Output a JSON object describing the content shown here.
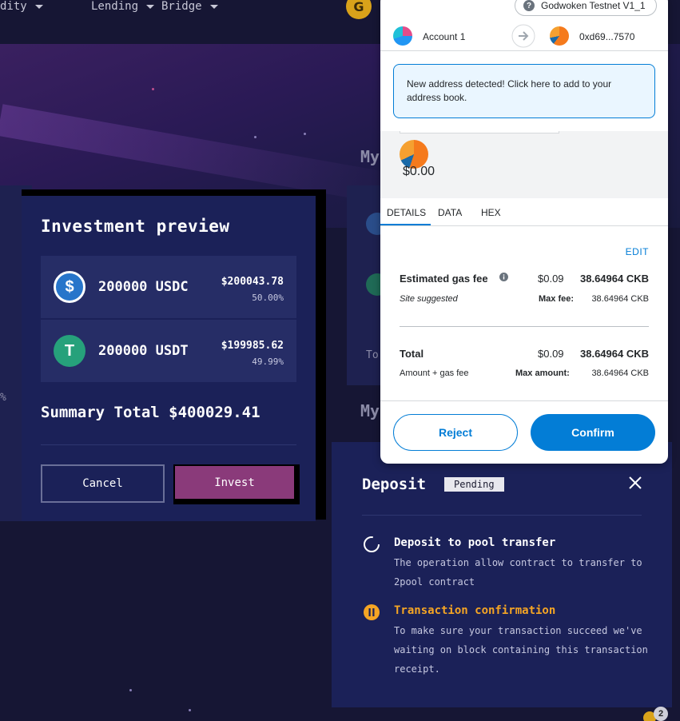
{
  "nav": {
    "items": [
      {
        "label": "dity"
      },
      {
        "label": "Lending"
      },
      {
        "label": "Bridge"
      }
    ],
    "logo_letter": "G"
  },
  "background": {
    "section_heading_1": "My",
    "section_heading_2": "My",
    "total_label": "To",
    "percent_fragment": "%"
  },
  "investment_preview": {
    "title": "Investment preview",
    "rows": [
      {
        "coin": "USDC",
        "amount": "200000 USDC",
        "usd": "$200043.78",
        "percent": "50.00%",
        "color": "#2775ca",
        "glyph": "$"
      },
      {
        "coin": "USDT",
        "amount": "200000 USDT",
        "usd": "$199985.62",
        "percent": "49.99%",
        "color": "#26a17b",
        "glyph": "T"
      }
    ],
    "summary": "Summary Total $400029.41",
    "cancel_label": "Cancel",
    "invest_label": "Invest"
  },
  "deposit": {
    "title": "Deposit",
    "status": "Pending",
    "steps": [
      {
        "title": "Deposit to pool transfer",
        "desc": "The operation allow contract to transfer to 2pool contract",
        "color": "#ffffff"
      },
      {
        "title": "Transaction confirmation",
        "desc": "To make sure your transaction succeed we've waiting on block containing this transaction receipt.",
        "color": "#f5a524"
      }
    ]
  },
  "metamask": {
    "network": "Godwoken Testnet V1_1",
    "from_account": "Account 1",
    "to_address": "0xd69...7570",
    "notice": "New address detected! Click here to add to your address book.",
    "value": "$0.00",
    "tabs": [
      "DETAILS",
      "DATA",
      "HEX"
    ],
    "edit_label": "EDIT",
    "gas": {
      "label": "Estimated gas fee",
      "usd": "$0.09",
      "amount": "38.64964 CKB",
      "site_suggested": "Site suggested",
      "max_fee_label": "Max fee:",
      "max_fee_value": "38.64964 CKB"
    },
    "total": {
      "label": "Total",
      "usd": "$0.09",
      "amount": "38.64964 CKB",
      "sub_label": "Amount + gas fee",
      "max_amount_label": "Max amount:",
      "max_amount_value": "38.64964 CKB"
    },
    "reject_label": "Reject",
    "confirm_label": "Confirm"
  },
  "corner_badge_count": "2"
}
